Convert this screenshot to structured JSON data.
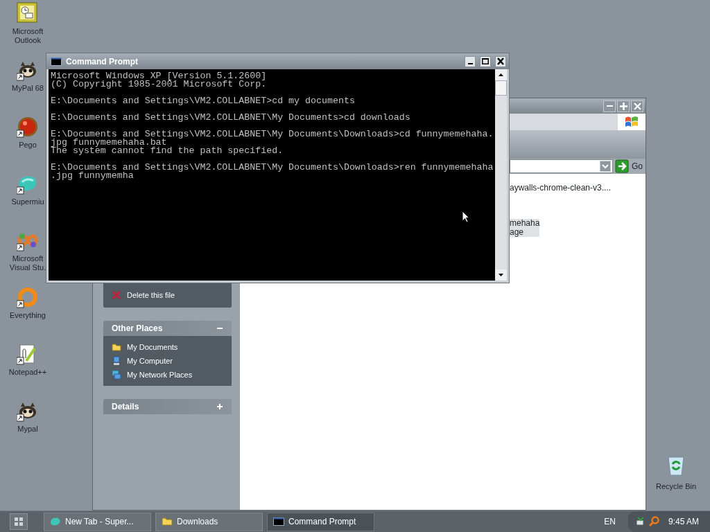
{
  "desktop_icons": [
    {
      "lines": [
        "Microsoft",
        "Outlook"
      ],
      "kind": "outlook",
      "shortcut": false
    },
    {
      "lines": [
        "MyPal 68"
      ],
      "kind": "raccoon",
      "shortcut": true
    },
    {
      "lines": [
        "Pego"
      ],
      "kind": "pego",
      "shortcut": true
    },
    {
      "lines": [
        "Supermiu"
      ],
      "kind": "supermium",
      "shortcut": true
    },
    {
      "lines": [
        "Microsoft",
        "Visual Stu."
      ],
      "kind": "visualstudio",
      "shortcut": true
    },
    {
      "lines": [
        "Everything"
      ],
      "kind": "everything",
      "shortcut": true
    },
    {
      "lines": [
        "Notepad++"
      ],
      "kind": "notepad",
      "shortcut": true
    },
    {
      "lines": [
        "Mypal"
      ],
      "kind": "raccoon",
      "shortcut": true
    }
  ],
  "recycle_bin": {
    "label": "Recycle Bin"
  },
  "explorer": {
    "go_button": "Go",
    "files": [
      {
        "lines": [
          "aywalls-chrome-clean-v3...."
        ],
        "selected": false
      },
      {
        "lines": [
          "mehaha",
          "age"
        ],
        "selected": true
      }
    ],
    "file_tasks": [
      {
        "label": "Delete this file",
        "kind": "delete"
      }
    ],
    "sections": [
      {
        "title": "Other Places",
        "expanded": true,
        "items": [
          {
            "label": "My Documents",
            "kind": "folder"
          },
          {
            "label": "My Computer",
            "kind": "computer"
          },
          {
            "label": "My Network Places",
            "kind": "network"
          }
        ]
      },
      {
        "title": "Details",
        "expanded": false
      }
    ]
  },
  "command_prompt": {
    "title": "Command Prompt",
    "blocks": [
      [
        "Microsoft Windows XP [Version 5.1.2600]",
        "(C) Copyright 1985-2001 Microsoft Corp."
      ],
      [
        "E:\\Documents and Settings\\VM2.COLLABNET>cd my documents"
      ],
      [
        "E:\\Documents and Settings\\VM2.COLLABNET\\My Documents>cd downloads"
      ],
      [
        "E:\\Documents and Settings\\VM2.COLLABNET\\My Documents\\Downloads>cd funnymemehaha.",
        "jpg funnymemehaha.bat",
        "The system cannot find the path specified."
      ],
      [
        "E:\\Documents and Settings\\VM2.COLLABNET\\My Documents\\Downloads>ren funnymemehaha",
        ".jpg funnymemha"
      ]
    ]
  },
  "taskbar": {
    "tasks": [
      {
        "label": "New Tab - Super...",
        "kind": "browser",
        "selected": false
      },
      {
        "label": "Downloads",
        "kind": "folder",
        "selected": false
      },
      {
        "label": "Command Prompt",
        "kind": "console",
        "selected": true
      }
    ],
    "language": "EN",
    "clock": "9:45 AM"
  }
}
